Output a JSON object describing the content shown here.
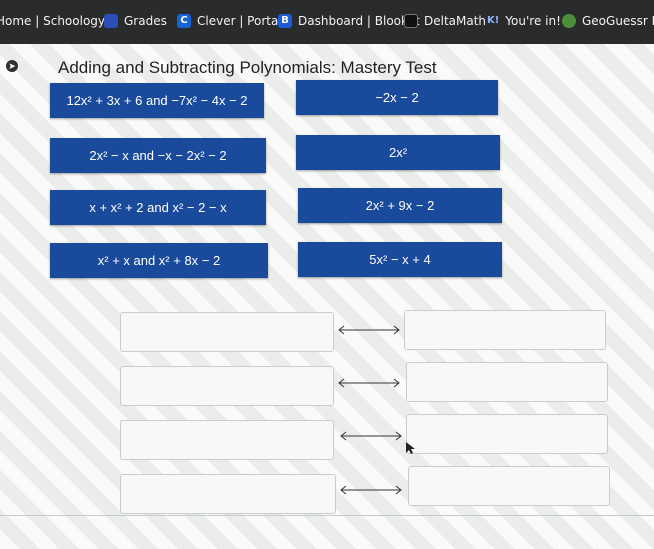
{
  "bookmarks": [
    {
      "label": "Home | Schoology",
      "icon": "none"
    },
    {
      "label": "Grades",
      "icon": "grades-icon",
      "color": "#2a4fb8"
    },
    {
      "label": "Clever | Portal",
      "icon": "clever-icon",
      "glyph": "C",
      "color": "#1464d8"
    },
    {
      "label": "Dashboard | Blooket",
      "icon": "blooket-icon",
      "glyph": "B",
      "color": "#1d5cd6"
    },
    {
      "label": "DeltaMath",
      "icon": "deltamath-icon",
      "color": "#222"
    },
    {
      "label": "You're in!",
      "icon": "kahoot-icon",
      "glyph": "K!",
      "color": "#2a2b2d"
    },
    {
      "label": "GeoGuessr Free |",
      "icon": "geoguessr-icon",
      "color": "#4c8f3a"
    }
  ],
  "page": {
    "title": "Adding and Subtracting Polynomials: Mastery Test"
  },
  "left_tiles": [
    "12x² + 3x + 6 and −7x² − 4x − 2",
    "2x² − x and −x − 2x² − 2",
    "x + x² + 2 and x² − 2 − x",
    "x² + x and x² + 8x − 2"
  ],
  "right_tiles": [
    "−2x − 2",
    "2x²",
    "2x² + 9x − 2",
    "5x² − x + 4"
  ],
  "pair_count": 4,
  "colors": {
    "tile": "#1a4a9c",
    "bookmarks_bar": "#2a2b2d"
  }
}
